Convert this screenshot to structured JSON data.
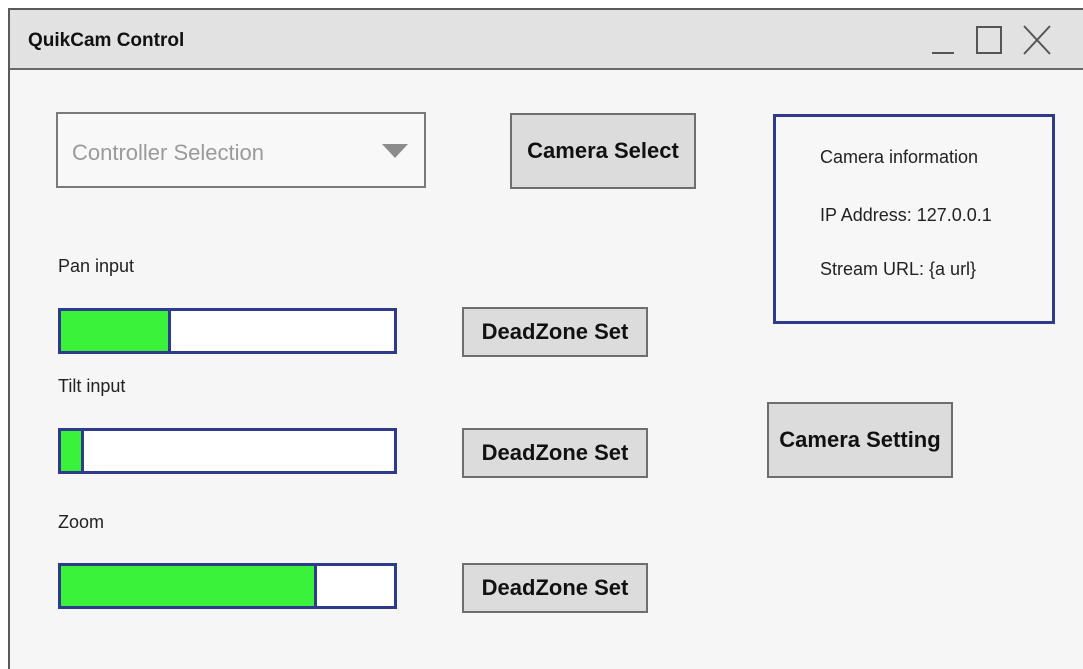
{
  "window": {
    "title": "QuikCam Control",
    "controls": {
      "minimize": "minimize-icon",
      "maximize": "maximize-icon",
      "close": "close-icon"
    }
  },
  "controller": {
    "placeholder": "Controller Selection"
  },
  "buttons": {
    "camera_select": "Camera Select",
    "camera_setting": "Camera Setting"
  },
  "camera_info": {
    "heading": "Camera information",
    "ip_address": "IP Address: 127.0.0.1",
    "stream_url": "Stream URL: {a url}"
  },
  "inputs": [
    {
      "label": "Pan input",
      "level": 0.33,
      "deadzone_label": "DeadZone Set"
    },
    {
      "label": "Tilt input",
      "level": 0.07,
      "deadzone_label": "DeadZone Set"
    },
    {
      "label": "Zoom",
      "level": 0.77,
      "deadzone_label": "DeadZone Set"
    }
  ],
  "colors": {
    "accent_border": "#2e3a8c",
    "fill": "#39f239"
  }
}
